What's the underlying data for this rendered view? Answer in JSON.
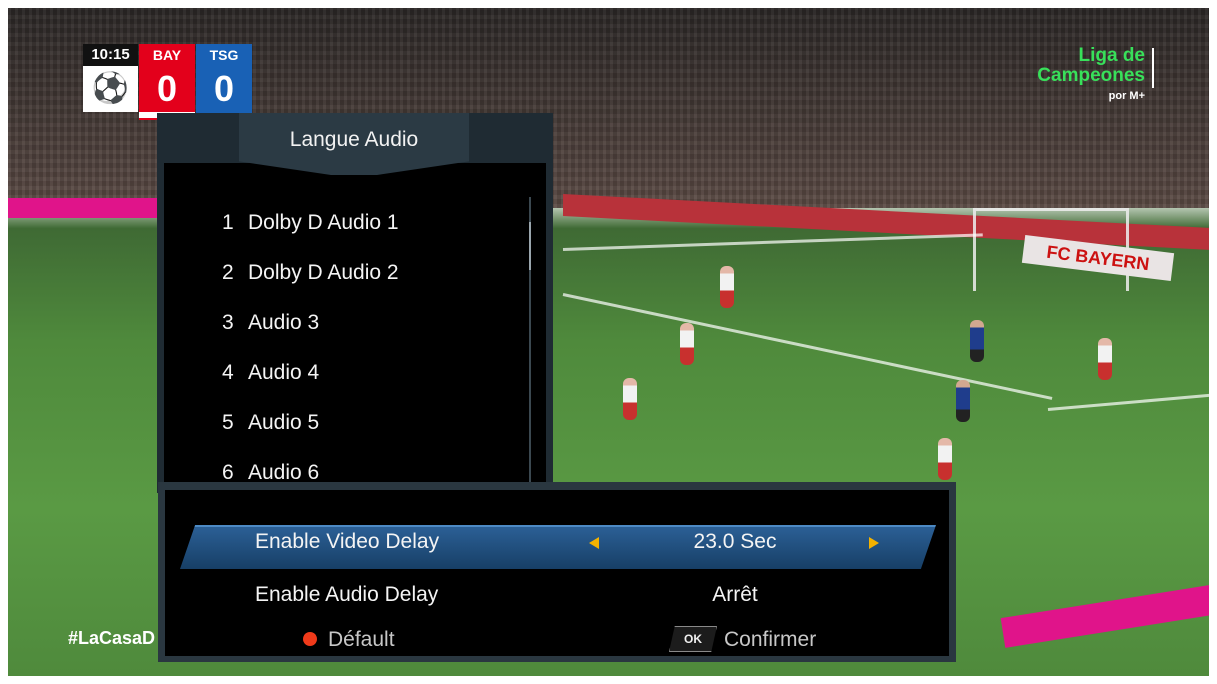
{
  "scoreboard": {
    "time": "10:15",
    "home": {
      "code": "BAY",
      "score": "0"
    },
    "away": {
      "code": "TSG",
      "score": "0"
    }
  },
  "brand": {
    "line1": "Liga de",
    "line2": "Campeones",
    "sub": "por M+"
  },
  "hashtag": "#LaCasaD",
  "audio_menu": {
    "title": "Langue Audio",
    "items": [
      {
        "num": "1",
        "label": "Dolby D Audio 1"
      },
      {
        "num": "2",
        "label": "Dolby D Audio 2"
      },
      {
        "num": "3",
        "label": "Audio 3"
      },
      {
        "num": "4",
        "label": "Audio 4"
      },
      {
        "num": "5",
        "label": "Audio 5"
      },
      {
        "num": "6",
        "label": "Audio 6"
      }
    ]
  },
  "delay_menu": {
    "video_delay": {
      "label": "Enable Video Delay",
      "value": "23.0 Sec"
    },
    "audio_delay": {
      "label": "Enable Audio Delay",
      "value": "Arrêt"
    }
  },
  "footer": {
    "default_label": "Défault",
    "ok_key": "OK",
    "confirm_label": "Confirmer"
  },
  "colors": {
    "highlight": "#1f4f80",
    "accent_arrow": "#f4b200",
    "red_button": "#f03a1a",
    "brand_green": "#38e05a"
  },
  "pitch_board": "FC BAYERN"
}
